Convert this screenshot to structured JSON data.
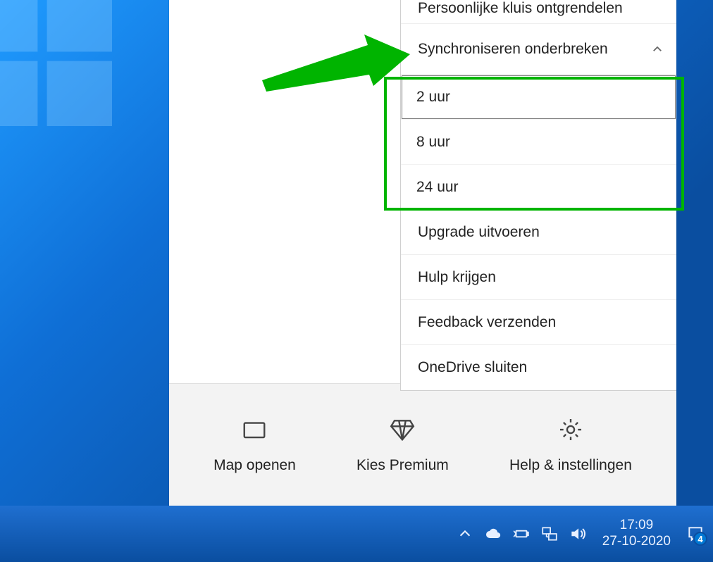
{
  "menu": {
    "unlock_vault": "Persoonlijke kluis ontgrendelen",
    "pause_sync": "Synchroniseren onderbreken",
    "sub": {
      "two": "2 uur",
      "eight": "8 uur",
      "twentyfour": "24 uur"
    },
    "upgrade": "Upgrade uitvoeren",
    "help": "Hulp krijgen",
    "feedback": "Feedback verzenden",
    "close": "OneDrive sluiten"
  },
  "footer": {
    "open_folder": "Map openen",
    "premium": "Kies Premium",
    "settings": "Help & instellingen"
  },
  "tray": {
    "time": "17:09",
    "date": "27-10-2020",
    "notif_count": "4"
  }
}
